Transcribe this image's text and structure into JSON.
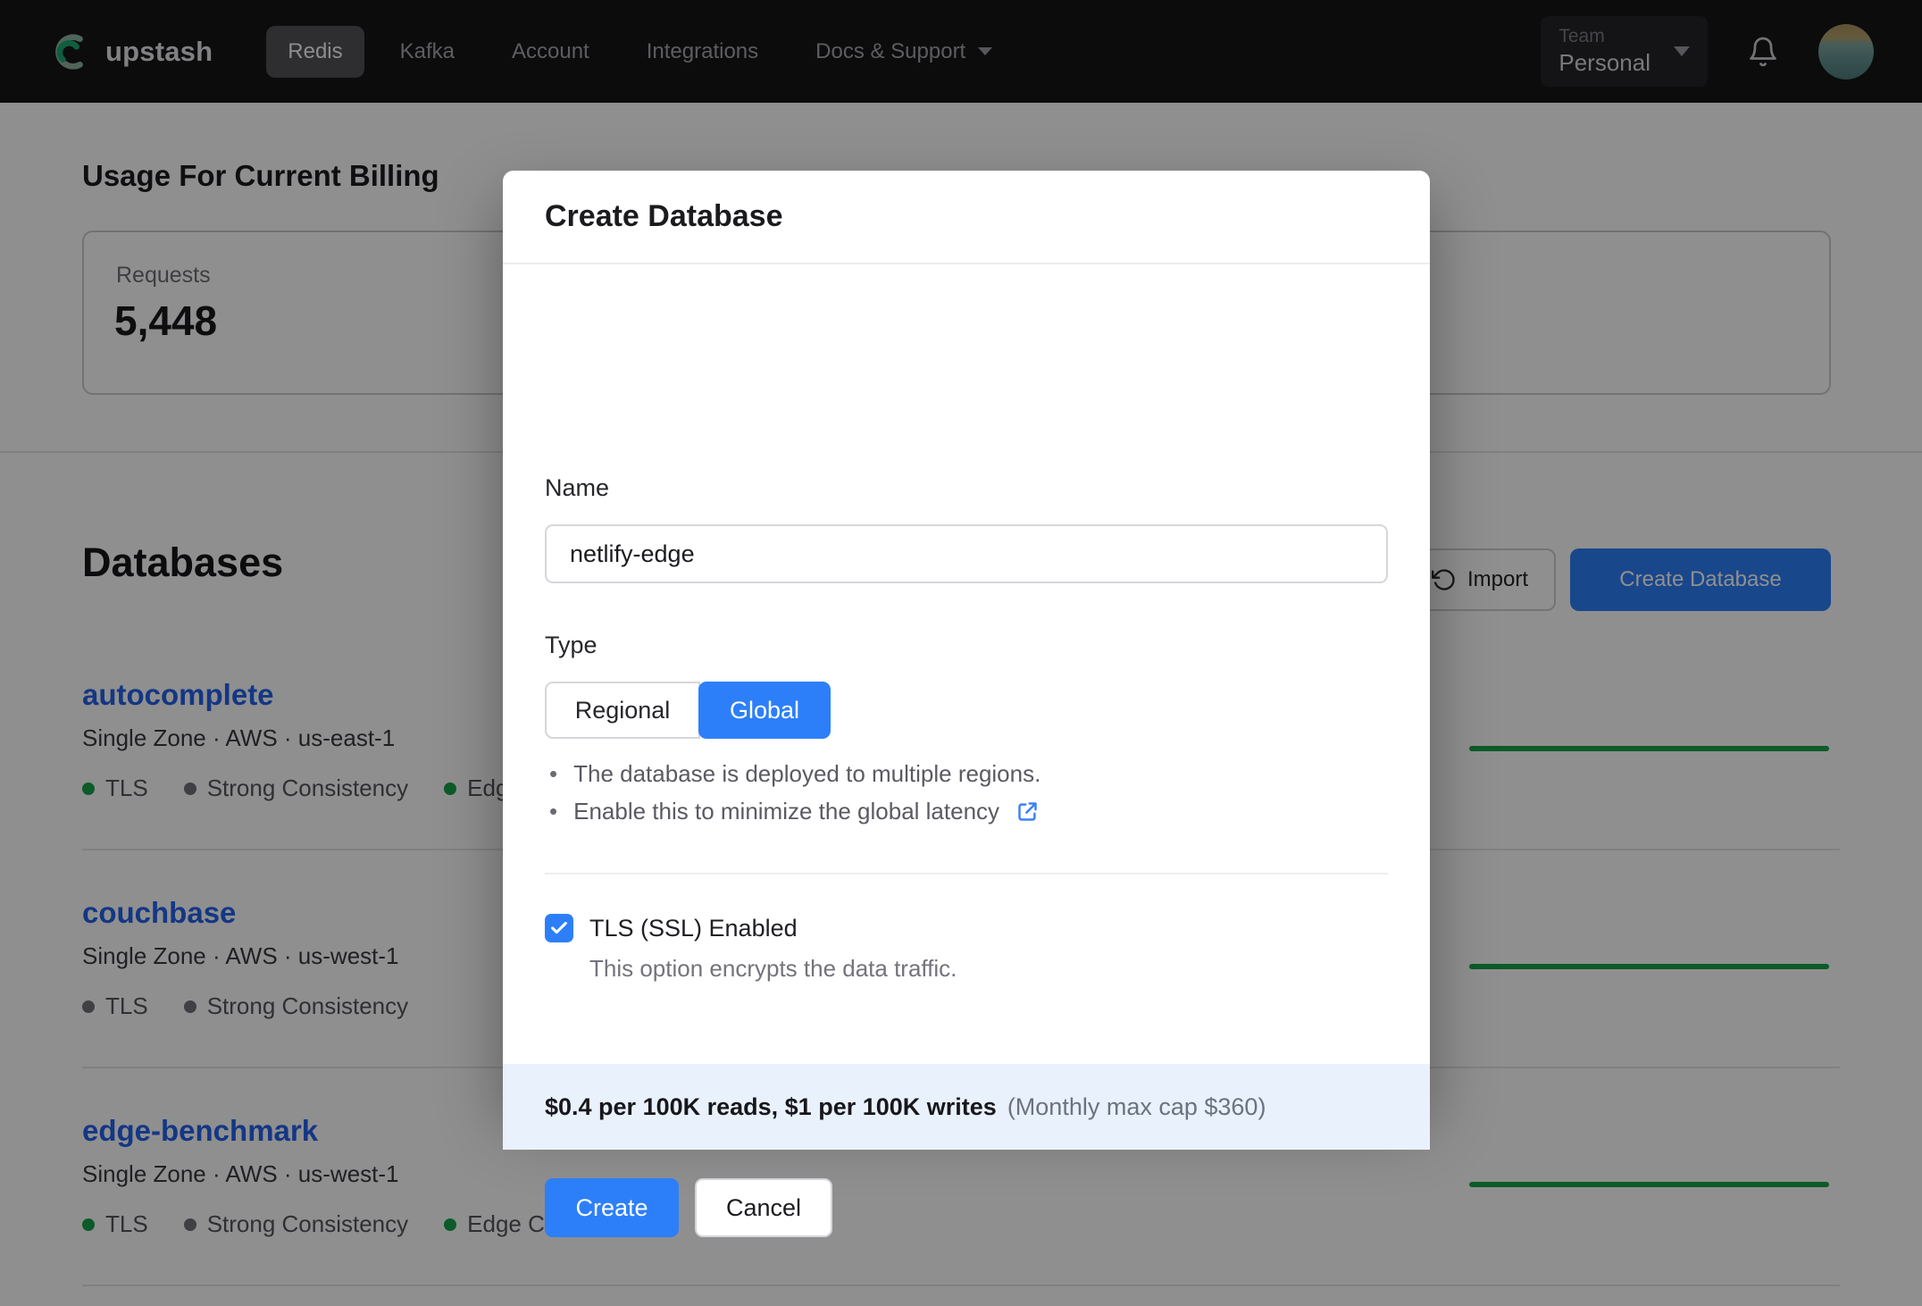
{
  "nav": {
    "brand": "upstash",
    "items": [
      {
        "label": "Redis"
      },
      {
        "label": "Kafka"
      },
      {
        "label": "Account"
      },
      {
        "label": "Integrations"
      },
      {
        "label": "Docs & Support"
      }
    ],
    "team": {
      "label": "Team",
      "value": "Personal"
    }
  },
  "usage": {
    "heading": "Usage For Current Billing",
    "requests_label": "Requests",
    "requests_value": "5,448"
  },
  "databases": {
    "heading": "Databases",
    "import_label": "Import",
    "create_label": "Create Database",
    "rows": [
      {
        "name": "autocomplete",
        "meta": "Single Zone · AWS · us-east-1",
        "badges": [
          {
            "label": "TLS",
            "dot": "#16a34a"
          },
          {
            "label": "Strong Consistency",
            "dot": "#71717a"
          },
          {
            "label": "Edge Caching",
            "dot": "#16a34a"
          }
        ]
      },
      {
        "name": "couchbase",
        "meta": "Single Zone · AWS · us-west-1",
        "badges": [
          {
            "label": "TLS",
            "dot": "#71717a"
          },
          {
            "label": "Strong Consistency",
            "dot": "#71717a"
          }
        ]
      },
      {
        "name": "edge-benchmark",
        "meta": "Single Zone · AWS · us-west-1",
        "badges": [
          {
            "label": "TLS",
            "dot": "#16a34a"
          },
          {
            "label": "Strong Consistency",
            "dot": "#71717a"
          },
          {
            "label": "Edge Caching",
            "dot": "#16a34a"
          }
        ]
      }
    ]
  },
  "modal": {
    "title": "Create Database",
    "name_label": "Name",
    "name_value": "netlify-edge",
    "type_label": "Type",
    "type_options": [
      {
        "label": "Regional",
        "selected": false
      },
      {
        "label": "Global",
        "selected": true
      }
    ],
    "bullets": [
      "The database is deployed to multiple regions.",
      "Enable this to minimize the global latency"
    ],
    "tls_label": "TLS (SSL) Enabled",
    "tls_desc": "This option encrypts the data traffic.",
    "tls_checked": true,
    "pricing_bold": "$0.4 per 100K reads, $1 per 100K writes",
    "pricing_note": "(Monthly max cap $360)",
    "create_label": "Create",
    "cancel_label": "Cancel"
  },
  "colors": {
    "accent": "#2d7ff9",
    "link_blue": "#2563eb",
    "green_dot": "#16a34a",
    "gray_dot": "#71717a",
    "sparkline_green": "#17a34a",
    "banner_bg": "#e9f1fc"
  }
}
